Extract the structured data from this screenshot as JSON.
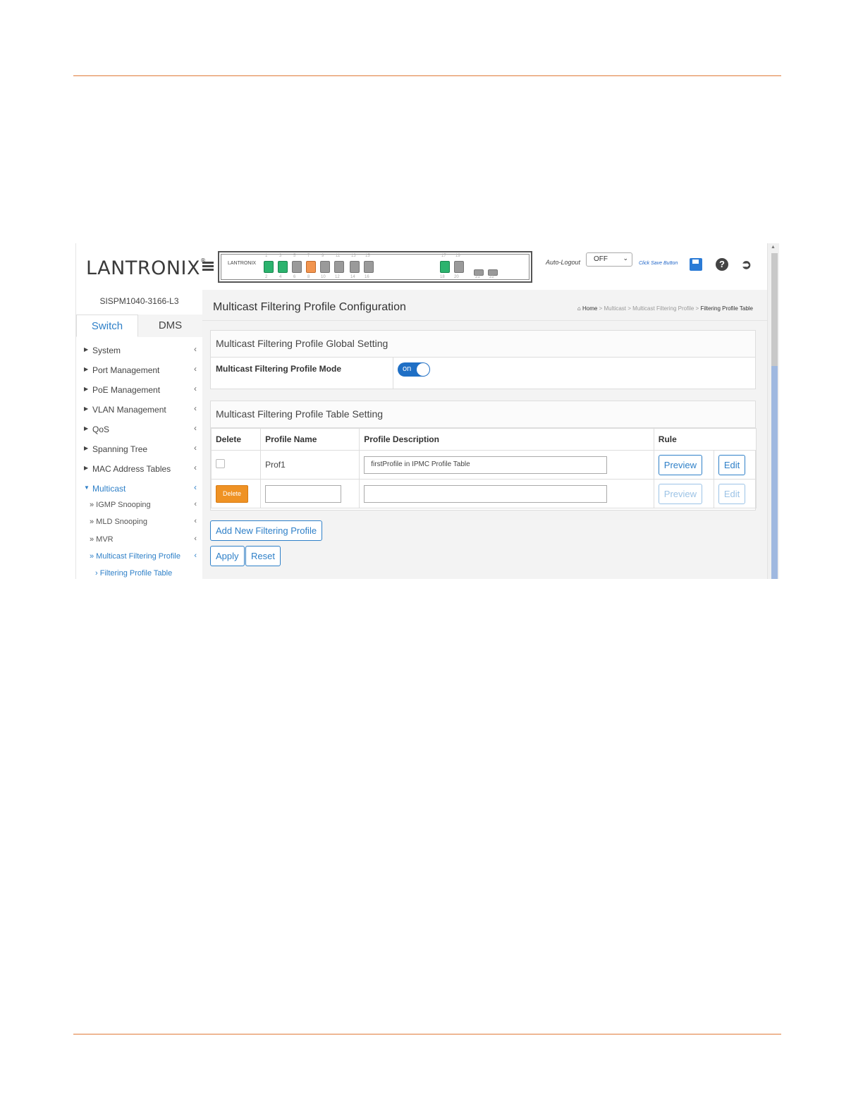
{
  "header": {
    "logo_text": "LANTRONIX",
    "registered": "®",
    "panel_logo": "LANTRONIX",
    "auto_logout_label": "Auto-Logout",
    "auto_logout_value": "OFF",
    "save_hint": "Click Save Button",
    "port_numbers_top": [
      "1",
      "3",
      "5",
      "7",
      "9",
      "11",
      "13",
      "15",
      "17",
      "19"
    ],
    "port_numbers_bottom": [
      "2",
      "4",
      "6",
      "8",
      "10",
      "12",
      "14",
      "16",
      "18",
      "20",
      "21",
      "22"
    ],
    "icons": [
      "menu-icon",
      "save-icon",
      "help-icon",
      "logout-icon"
    ]
  },
  "sidebar": {
    "device_name": "SISPM1040-3166-L3",
    "tabs": [
      "Switch",
      "DMS"
    ],
    "items": [
      {
        "label": "System"
      },
      {
        "label": "Port Management"
      },
      {
        "label": "PoE Management"
      },
      {
        "label": "VLAN Management"
      },
      {
        "label": "QoS"
      },
      {
        "label": "Spanning Tree"
      },
      {
        "label": "MAC Address Tables"
      },
      {
        "label": "Multicast"
      }
    ],
    "multicast_sub": [
      {
        "label": "» IGMP Snooping"
      },
      {
        "label": "» MLD Snooping"
      },
      {
        "label": "» MVR"
      },
      {
        "label": "» Multicast Filtering Profile"
      }
    ],
    "filtering_sub": "› Filtering Profile Table"
  },
  "main": {
    "title": "Multicast Filtering Profile Configuration",
    "breadcrumb": {
      "home": "Home",
      "multicast": "Multicast",
      "mfp": "Multicast Filtering Profile",
      "current": "Filtering Profile Table",
      "sep": ">"
    },
    "global": {
      "heading": "Multicast Filtering Profile Global Setting",
      "mode_label": "Multicast Filtering Profile Mode",
      "mode_value": "on"
    },
    "table": {
      "heading": "Multicast Filtering Profile Table Setting",
      "columns": [
        "Delete",
        "Profile Name",
        "Profile Description",
        "Rule"
      ],
      "rows": [
        {
          "name": "Prof1",
          "description": "firstProfile in IPMC Profile Table",
          "preview": "Preview",
          "edit": "Edit"
        },
        {
          "delete": "Delete",
          "name": "",
          "description": "",
          "preview": "Preview",
          "edit": "Edit"
        }
      ]
    },
    "buttons": {
      "add": "Add New Filtering Profile",
      "apply": "Apply",
      "reset": "Reset"
    }
  },
  "colors": {
    "accent_blue": "#2f80c8",
    "accent_orange": "#ef9224",
    "rule_orange": "#e07b39"
  }
}
